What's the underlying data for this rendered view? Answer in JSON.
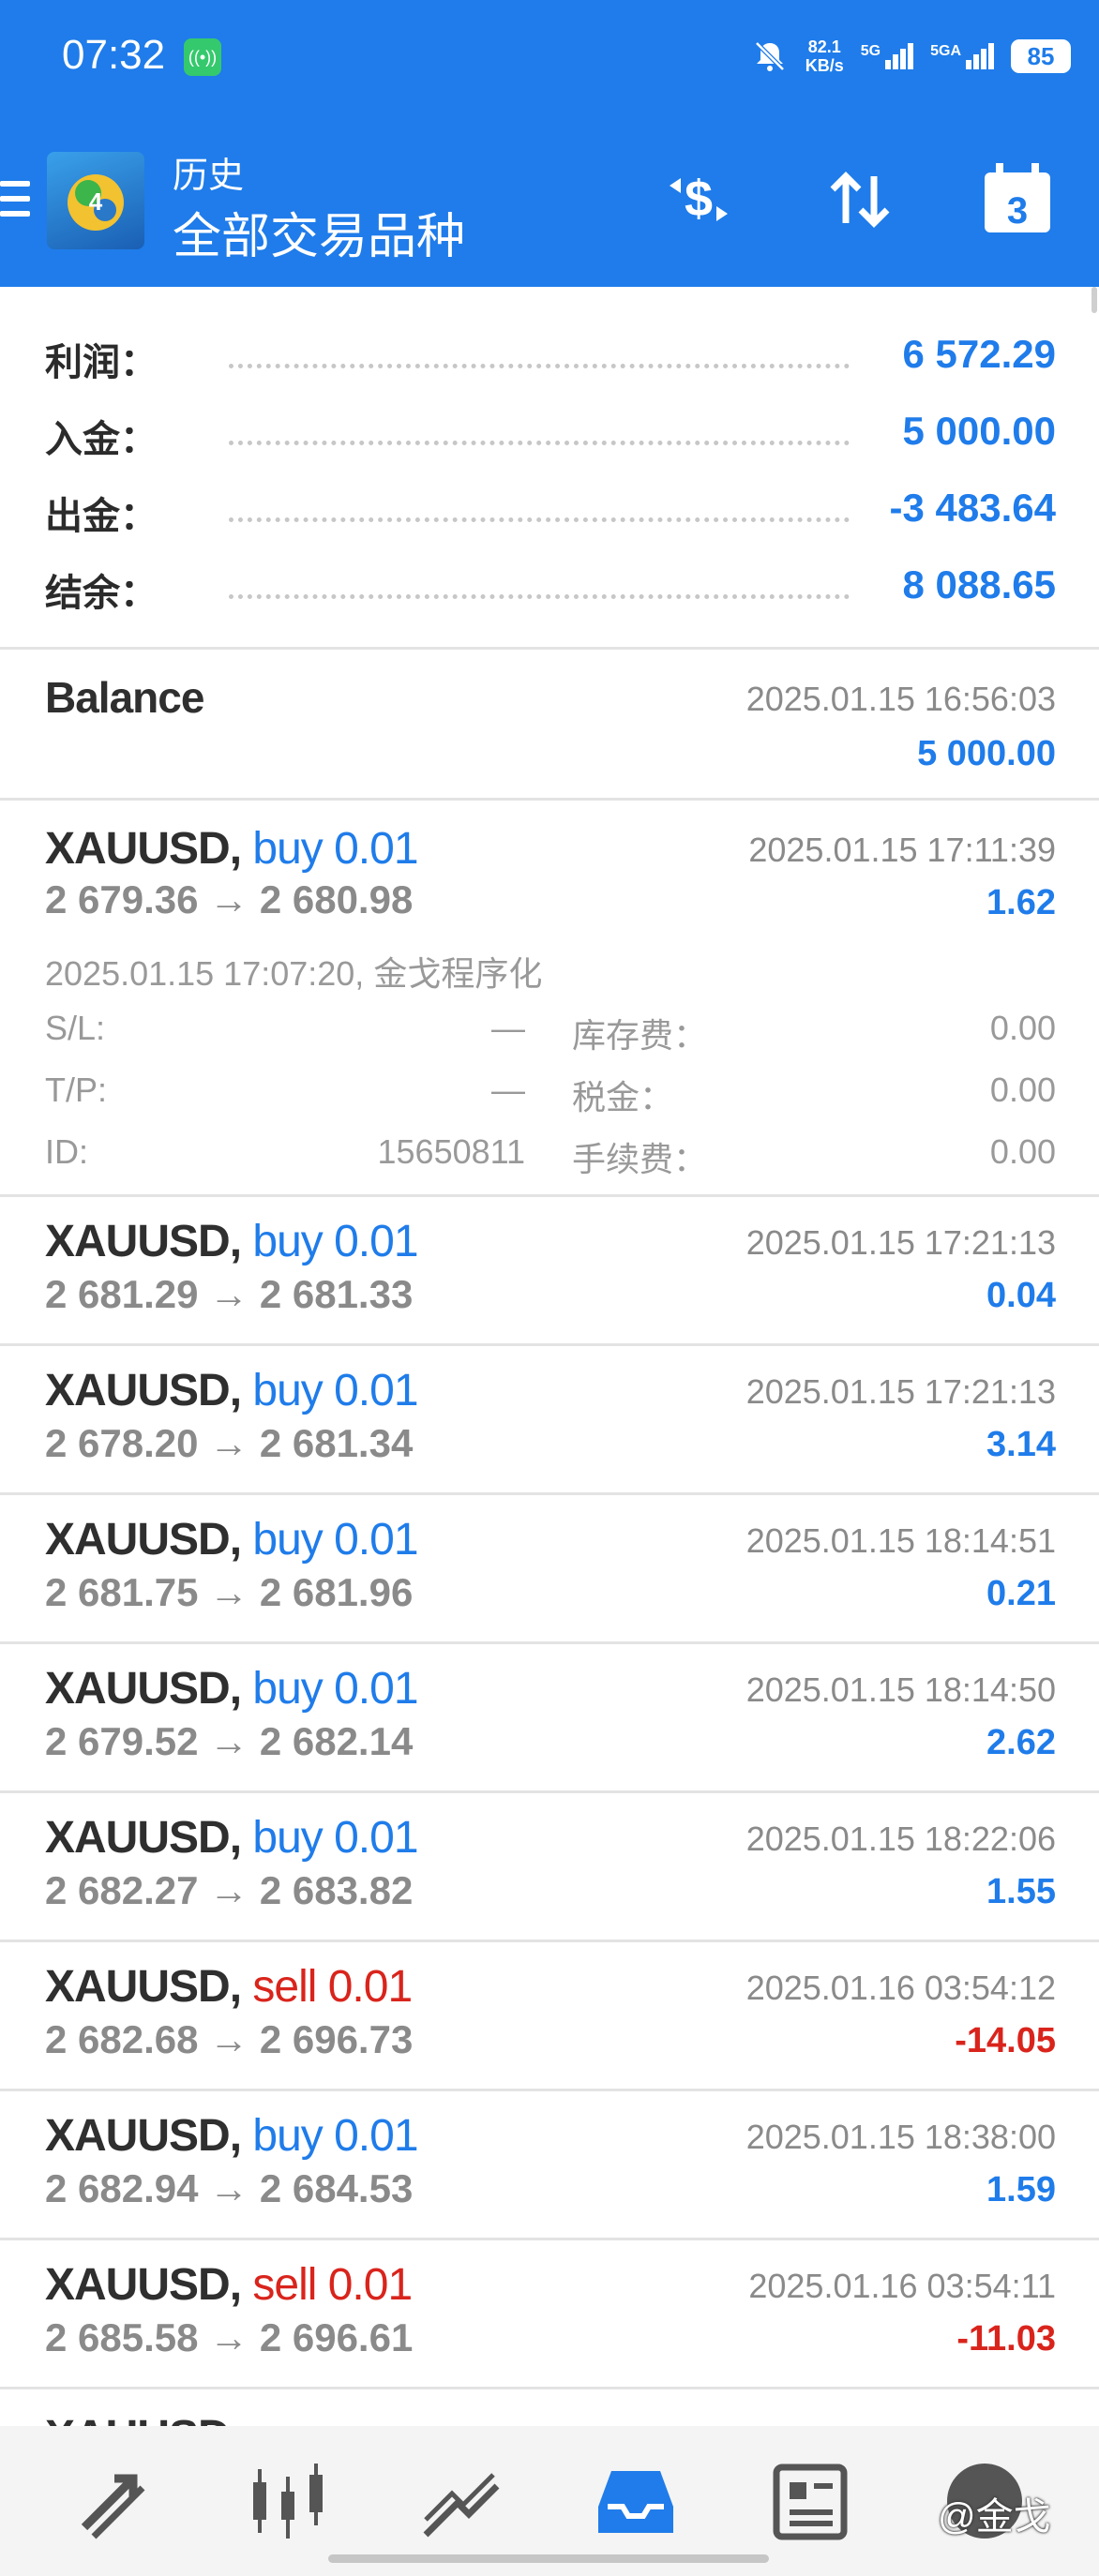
{
  "status_bar": {
    "time": "07:32",
    "net_speed_value": "82.1",
    "net_speed_unit": "KB/s",
    "signal1_label": "5G",
    "signal2_label": "5GA",
    "battery": "85"
  },
  "header": {
    "subtitle": "历史",
    "title": "全部交易品种",
    "calendar_day": "3"
  },
  "summary": [
    {
      "label": "利润：",
      "value": "6 572.29"
    },
    {
      "label": "入金：",
      "value": "5 000.00"
    },
    {
      "label": "出金：",
      "value": "-3 483.64"
    },
    {
      "label": "结余：",
      "value": "8 088.65"
    }
  ],
  "balance_entry": {
    "label": "Balance",
    "time": "2025.01.15 16:56:03",
    "amount": "5 000.00"
  },
  "expanded_trade": {
    "symbol": "XAUUSD,",
    "side": "buy 0.01",
    "prices": "2 679.36 → 2 680.98",
    "time": "2025.01.15 17:11:39",
    "profit": "1.62",
    "open_info": "2025.01.15 17:07:20, 金戈程序化",
    "sl_label": "S/L:",
    "sl_value": "—",
    "tp_label": "T/P:",
    "tp_value": "—",
    "id_label": "ID:",
    "id_value": "15650811",
    "swap_label": "库存费：",
    "swap_value": "0.00",
    "tax_label": "税金：",
    "tax_value": "0.00",
    "fee_label": "手续费：",
    "fee_value": "0.00"
  },
  "trades": [
    {
      "symbol": "XAUUSD,",
      "side": "buy 0.01",
      "prices": "2 681.29 → 2 681.33",
      "time": "2025.01.15 17:21:13",
      "profit": "0.04"
    },
    {
      "symbol": "XAUUSD,",
      "side": "buy 0.01",
      "prices": "2 678.20 → 2 681.34",
      "time": "2025.01.15 17:21:13",
      "profit": "3.14"
    },
    {
      "symbol": "XAUUSD,",
      "side": "buy 0.01",
      "prices": "2 681.75 → 2 681.96",
      "time": "2025.01.15 18:14:51",
      "profit": "0.21"
    },
    {
      "symbol": "XAUUSD,",
      "side": "buy 0.01",
      "prices": "2 679.52 → 2 682.14",
      "time": "2025.01.15 18:14:50",
      "profit": "2.62"
    },
    {
      "symbol": "XAUUSD,",
      "side": "buy 0.01",
      "prices": "2 682.27 → 2 683.82",
      "time": "2025.01.15 18:22:06",
      "profit": "1.55"
    },
    {
      "symbol": "XAUUSD,",
      "side": "sell 0.01",
      "prices": "2 682.68 → 2 696.73",
      "time": "2025.01.16 03:54:12",
      "profit": "-14.05"
    },
    {
      "symbol": "XAUUSD,",
      "side": "buy 0.01",
      "prices": "2 682.94 → 2 684.53",
      "time": "2025.01.15 18:38:00",
      "profit": "1.59"
    },
    {
      "symbol": "XAUUSD,",
      "side": "sell 0.01",
      "prices": "2 685.58 → 2 696.61",
      "time": "2025.01.16 03:54:11",
      "profit": "-11.03"
    }
  ],
  "watermark": "@金戈",
  "colors": {
    "accent": "#1f7cea",
    "negative": "#d9241c",
    "muted": "#8a8a8a"
  }
}
